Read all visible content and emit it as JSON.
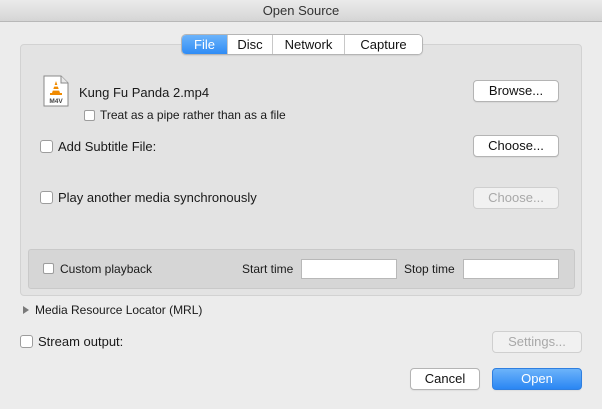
{
  "window": {
    "title": "Open Source"
  },
  "tabs": [
    {
      "label": "File",
      "active": true
    },
    {
      "label": "Disc",
      "active": false
    },
    {
      "label": "Network",
      "active": false
    },
    {
      "label": "Capture",
      "active": false
    }
  ],
  "file": {
    "icon_label": "M4V",
    "icon_name": "vlc-media-file-icon",
    "filename": "Kung Fu Panda 2.mp4",
    "browse_label": "Browse...",
    "pipe_label": "Treat as a pipe rather than as a file",
    "pipe_checked": false
  },
  "subtitle": {
    "label": "Add Subtitle File:",
    "checked": false,
    "choose_label": "Choose..."
  },
  "sync": {
    "label": "Play another media synchronously",
    "checked": false,
    "choose_label": "Choose...",
    "choose_enabled": false
  },
  "playback": {
    "custom_label": "Custom playback",
    "custom_checked": false,
    "start_label": "Start time",
    "start_value": "",
    "stop_label": "Stop time",
    "stop_value": ""
  },
  "mrl": {
    "label": "Media Resource Locator (MRL)",
    "expanded": false
  },
  "stream": {
    "label": "Stream output:",
    "checked": false,
    "settings_label": "Settings...",
    "settings_enabled": false
  },
  "footer": {
    "cancel_label": "Cancel",
    "open_label": "Open"
  },
  "colors": {
    "accent": "#2f8cf5",
    "vlc_cone": "#f08a00"
  }
}
